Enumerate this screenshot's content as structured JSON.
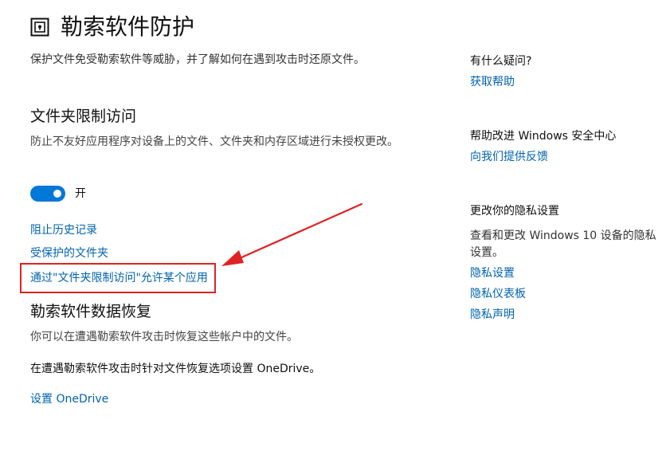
{
  "header": {
    "title": "勒索软件防护",
    "intro": "保护文件免受勒索软件等威胁，并了解如何在遇到攻击时还原文件。"
  },
  "cfa": {
    "title": "文件夹限制访问",
    "description": "防止不友好应用程序对设备上的文件、文件夹和内存区域进行未授权更改。",
    "toggle_state": "on",
    "toggle_label": "开",
    "links": {
      "block_history": "阻止历史记录",
      "protected_folders": "受保护的文件夹",
      "allow_app": "通过\"文件夹限制访问\"允许某个应用"
    }
  },
  "recovery": {
    "title": "勒索软件数据恢复",
    "description": "你可以在遭遇勒索软件攻击时恢复这些帐户中的文件。",
    "onedrive_text": "在遭遇勒索软件攻击时针对文件恢复选项设置 OneDrive。",
    "setup_link": "设置 OneDrive"
  },
  "sidebar": {
    "question": {
      "title": "有什么疑问?",
      "link": "获取帮助"
    },
    "improve": {
      "title": "帮助改进 Windows 安全中心",
      "link": "向我们提供反馈"
    },
    "privacy": {
      "title": "更改你的隐私设置",
      "description": "查看和更改 Windows 10 设备的隐私设置。",
      "links": [
        "隐私设置",
        "隐私仪表板",
        "隐私声明"
      ]
    }
  },
  "colors": {
    "accent": "#0078d7",
    "link": "#0063b1",
    "annotation": "#e02222"
  }
}
